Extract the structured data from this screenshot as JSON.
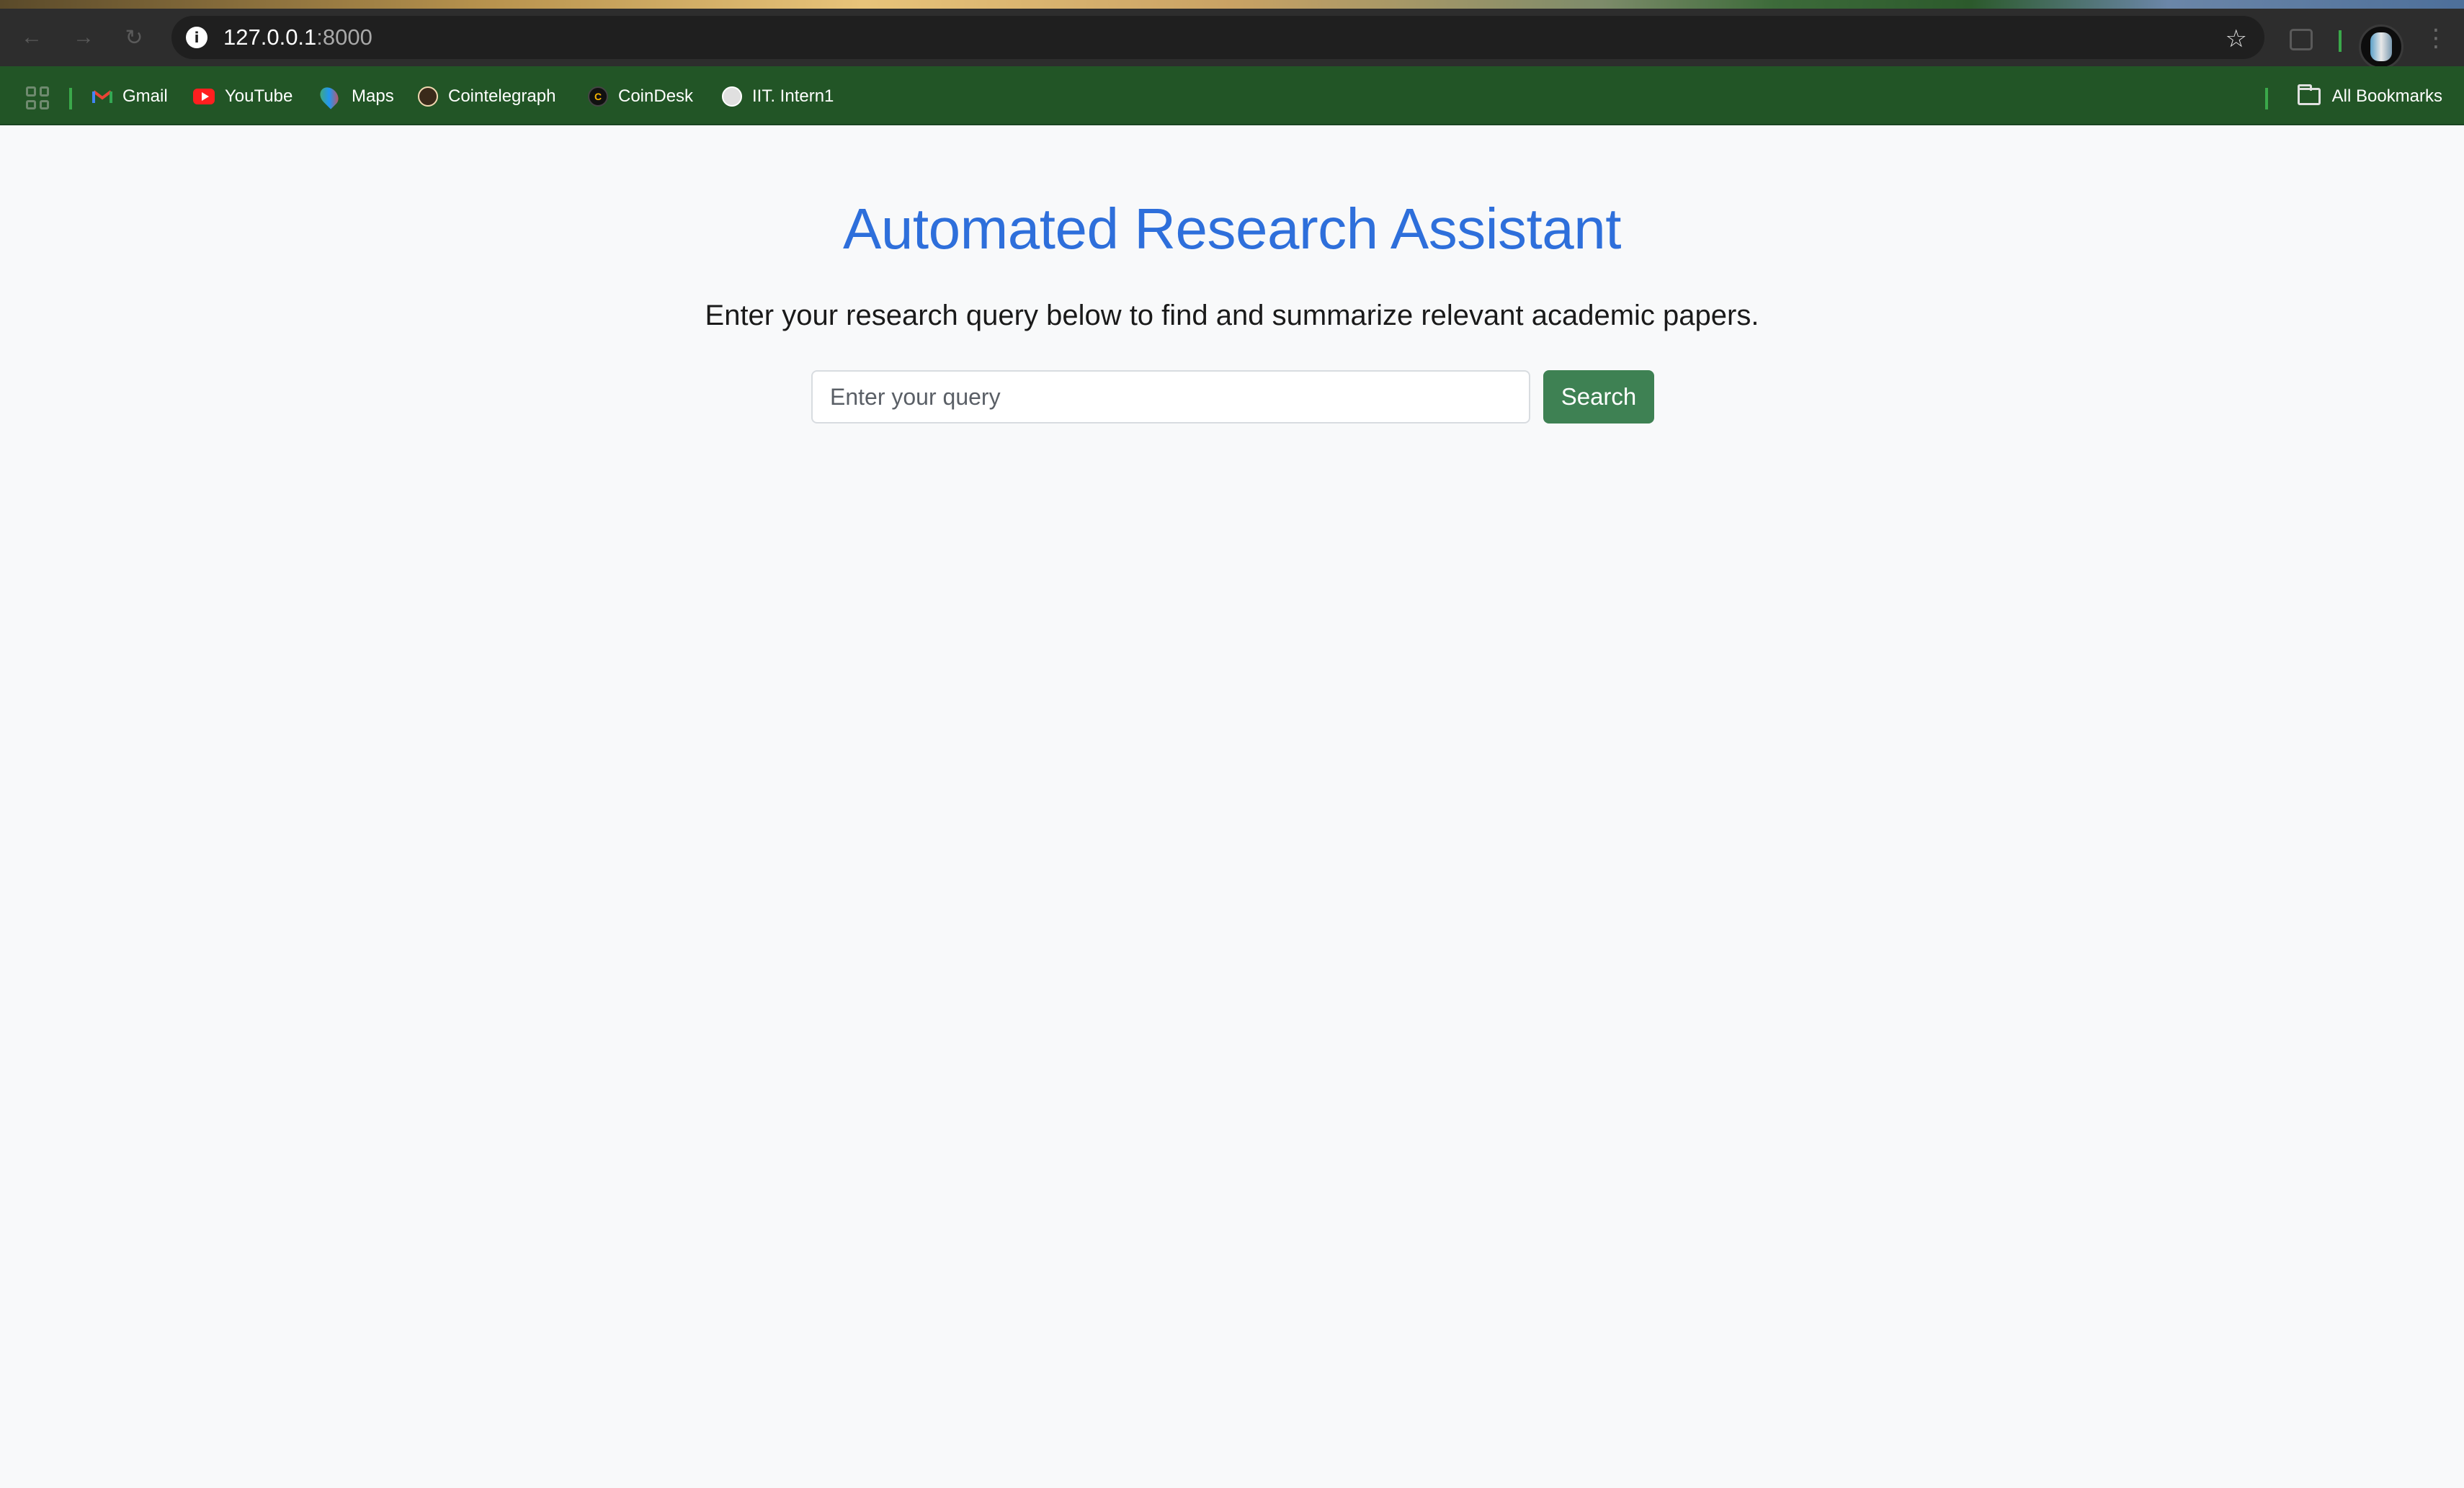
{
  "browser": {
    "url_host": "127.0.0.1",
    "url_port": ":8000",
    "bookmarks": [
      {
        "label": "Gmail",
        "icon": "gmail-icon"
      },
      {
        "label": "YouTube",
        "icon": "youtube-icon"
      },
      {
        "label": "Maps",
        "icon": "maps-icon"
      },
      {
        "label": "Cointelegraph",
        "icon": "cointelegraph-icon"
      },
      {
        "label": "CoinDesk",
        "icon": "coindesk-icon"
      },
      {
        "label": "IIT. Intern1",
        "icon": "iit-icon"
      }
    ],
    "all_bookmarks_label": "All Bookmarks"
  },
  "page": {
    "title": "Automated Research Assistant",
    "subtitle": "Enter your research query below to find and summarize relevant academic papers.",
    "search_placeholder": "Enter your query",
    "search_value": "",
    "search_button_label": "Search"
  },
  "colors": {
    "title": "#2e6fdb",
    "button": "#3e8153",
    "bookmarks_bar": "#225526",
    "background": "#f8f9fa"
  }
}
